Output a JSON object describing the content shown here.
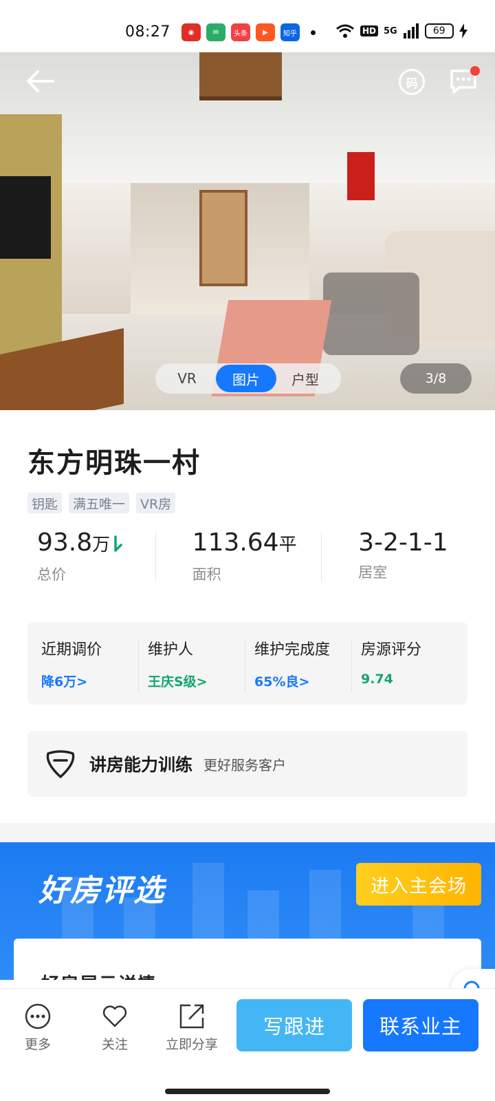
{
  "status_bar": {
    "time": "08:27",
    "app_icons": [
      {
        "name": "pinduoduo-icon",
        "label": "",
        "color": "#e02e24"
      },
      {
        "name": "wechat-icon",
        "label": "",
        "color": "#2aae67"
      },
      {
        "name": "toutiao-icon",
        "label": "头条",
        "color": "#f04142"
      },
      {
        "name": "video-play-icon",
        "label": "",
        "color": "#ff5722"
      },
      {
        "name": "zhihu-icon",
        "label": "知乎",
        "color": "#0a66e8"
      }
    ],
    "network": "5G",
    "hd": "HD",
    "battery": "69"
  },
  "hero": {
    "media_tabs": [
      "VR",
      "图片",
      "户型"
    ],
    "active_tab": "图片",
    "counter": "3/8",
    "qr_label": "码"
  },
  "listing": {
    "title": "东方明珠一村",
    "tags": [
      "钥匙",
      "满五唯一",
      "VR房"
    ],
    "stats": {
      "price_value": "93.8",
      "price_unit": "万",
      "price_label": "总价",
      "area_value": "113.64",
      "area_unit": "平",
      "area_label": "面积",
      "rooms_value": "3-2-1-1",
      "rooms_label": "居室"
    }
  },
  "metrics": [
    {
      "label": "近期调价",
      "value": "降6万>",
      "color": "blue"
    },
    {
      "label": "维护人",
      "value": "王庆S级>",
      "color": "green"
    },
    {
      "label": "维护完成度",
      "value": "65%良>",
      "color": "blue"
    },
    {
      "label": "房源评分",
      "value": "9.74",
      "color": "green"
    }
  ],
  "training": {
    "title": "讲房能力训练",
    "subtitle": "更好服务客户"
  },
  "promo": {
    "title": "好房评选",
    "enter_button": "进入主会场",
    "detail_title": "好房展示详情"
  },
  "bottom_bar": {
    "more": "更多",
    "follow": "关注",
    "share": "立即分享",
    "follow_up_button": "写跟进",
    "contact_button": "联系业主"
  },
  "colors": {
    "accent": "#1677ff",
    "green": "#11a86b",
    "orange": "#ffb400"
  }
}
